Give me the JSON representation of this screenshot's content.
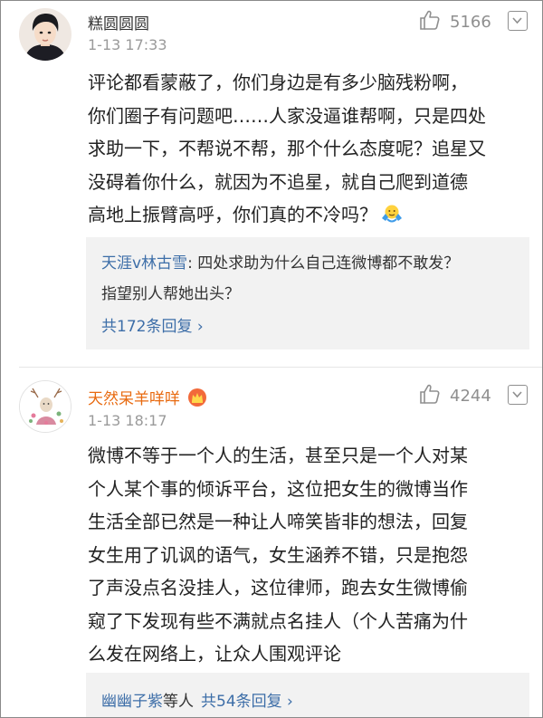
{
  "comments": [
    {
      "username": "糕圆圆圆",
      "time": "1-13 17:33",
      "likes": "5166",
      "lines": [
        "评论都看蒙蔽了，你们身边是有多少脑残粉啊，",
        "你们圈子有问题吧……人家没逼谁帮啊，只是四处",
        "求助一下，不帮说不帮，那个什么态度呢？追星又",
        "没碍着你什么，就因为不追星，就自己爬到道德",
        "高地上振臂高呼，你们真的不冷吗？"
      ],
      "emoji": "shrug-emoji",
      "reply": {
        "author": "天涯v林古雪",
        "text_line1": ": 四处求助为什么自己连微博都不敢发？",
        "text_line2": "指望别人帮她出头？",
        "count_label": "共172条回复 ›"
      }
    },
    {
      "username": "天然呆羊咩咩",
      "name_color": "#e86a10",
      "badge": "crown-badge-icon",
      "time": "1-13 18:17",
      "likes": "4244",
      "lines": [
        "微博不等于一个人的生活，甚至只是一个人对某",
        "个人某个事的倾诉平台，这位把女生的微博当作",
        "生活全部已然是一种让人啼笑皆非的想法，回复",
        "女生用了讥讽的语气，女生涵养不错，只是抱怨",
        "了声没点名没挂人，这位律师，跑去女生微博偷",
        "窥了下发现有些不满就点名挂人（个人苦痛为什",
        "么发在网络上，让众人围观评论"
      ],
      "reply": {
        "author": "幽幽子紫",
        "others": "等人",
        "count_label": "共54条回复 ›"
      }
    }
  ],
  "colors": {
    "link": "#3d6ea8",
    "muted": "#9a9a9a",
    "reply_bg": "#f2f2f2",
    "orange_name": "#e86a10"
  }
}
